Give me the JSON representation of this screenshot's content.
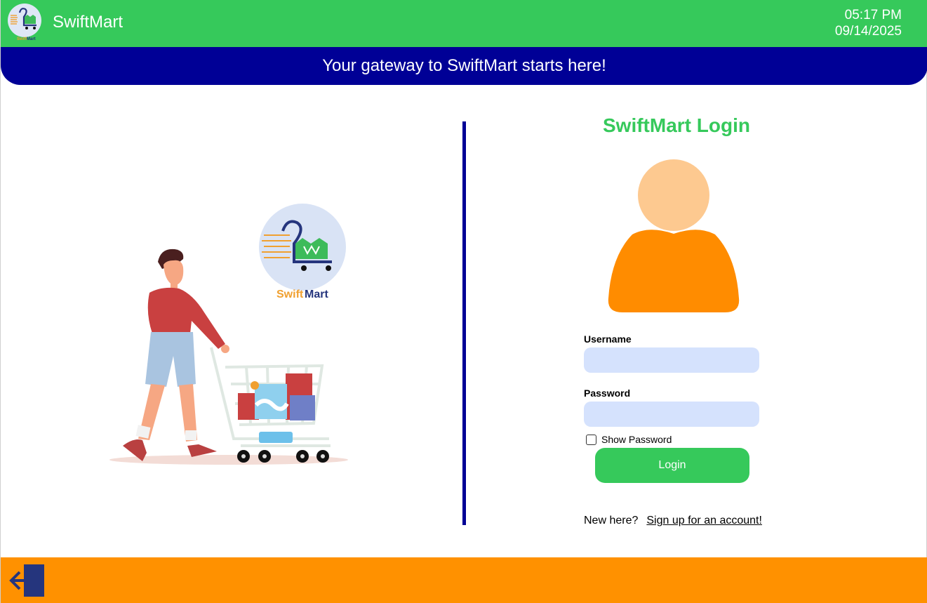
{
  "header": {
    "app_title": "SwiftMart",
    "time": "05:17 PM",
    "date": "09/14/2025",
    "logo_icon": "swiftmart-cart-logo"
  },
  "banner": {
    "text": "Your gateway to SwiftMart starts here!"
  },
  "illustration": {
    "brand_text_swift": "Swift",
    "brand_text_mart": "Mart",
    "icon": "shopper-with-cart-illustration"
  },
  "login": {
    "title": "SwiftMart Login",
    "avatar_icon": "user-avatar-icon",
    "username_label": "Username",
    "username_value": "",
    "password_label": "Password",
    "password_value": "",
    "show_password_label": "Show Password",
    "show_password_checked": false,
    "login_button": "Login",
    "signup_prompt": "New here?",
    "signup_link": "Sign up for an account!"
  },
  "footer": {
    "exit_icon": "exit-icon"
  },
  "colors": {
    "header_green": "#36c95b",
    "banner_navy": "#000096",
    "footer_orange": "#ff9100",
    "input_bg": "#d5e2fd",
    "avatar_head": "#fdc990",
    "avatar_body": "#ff8c00"
  }
}
